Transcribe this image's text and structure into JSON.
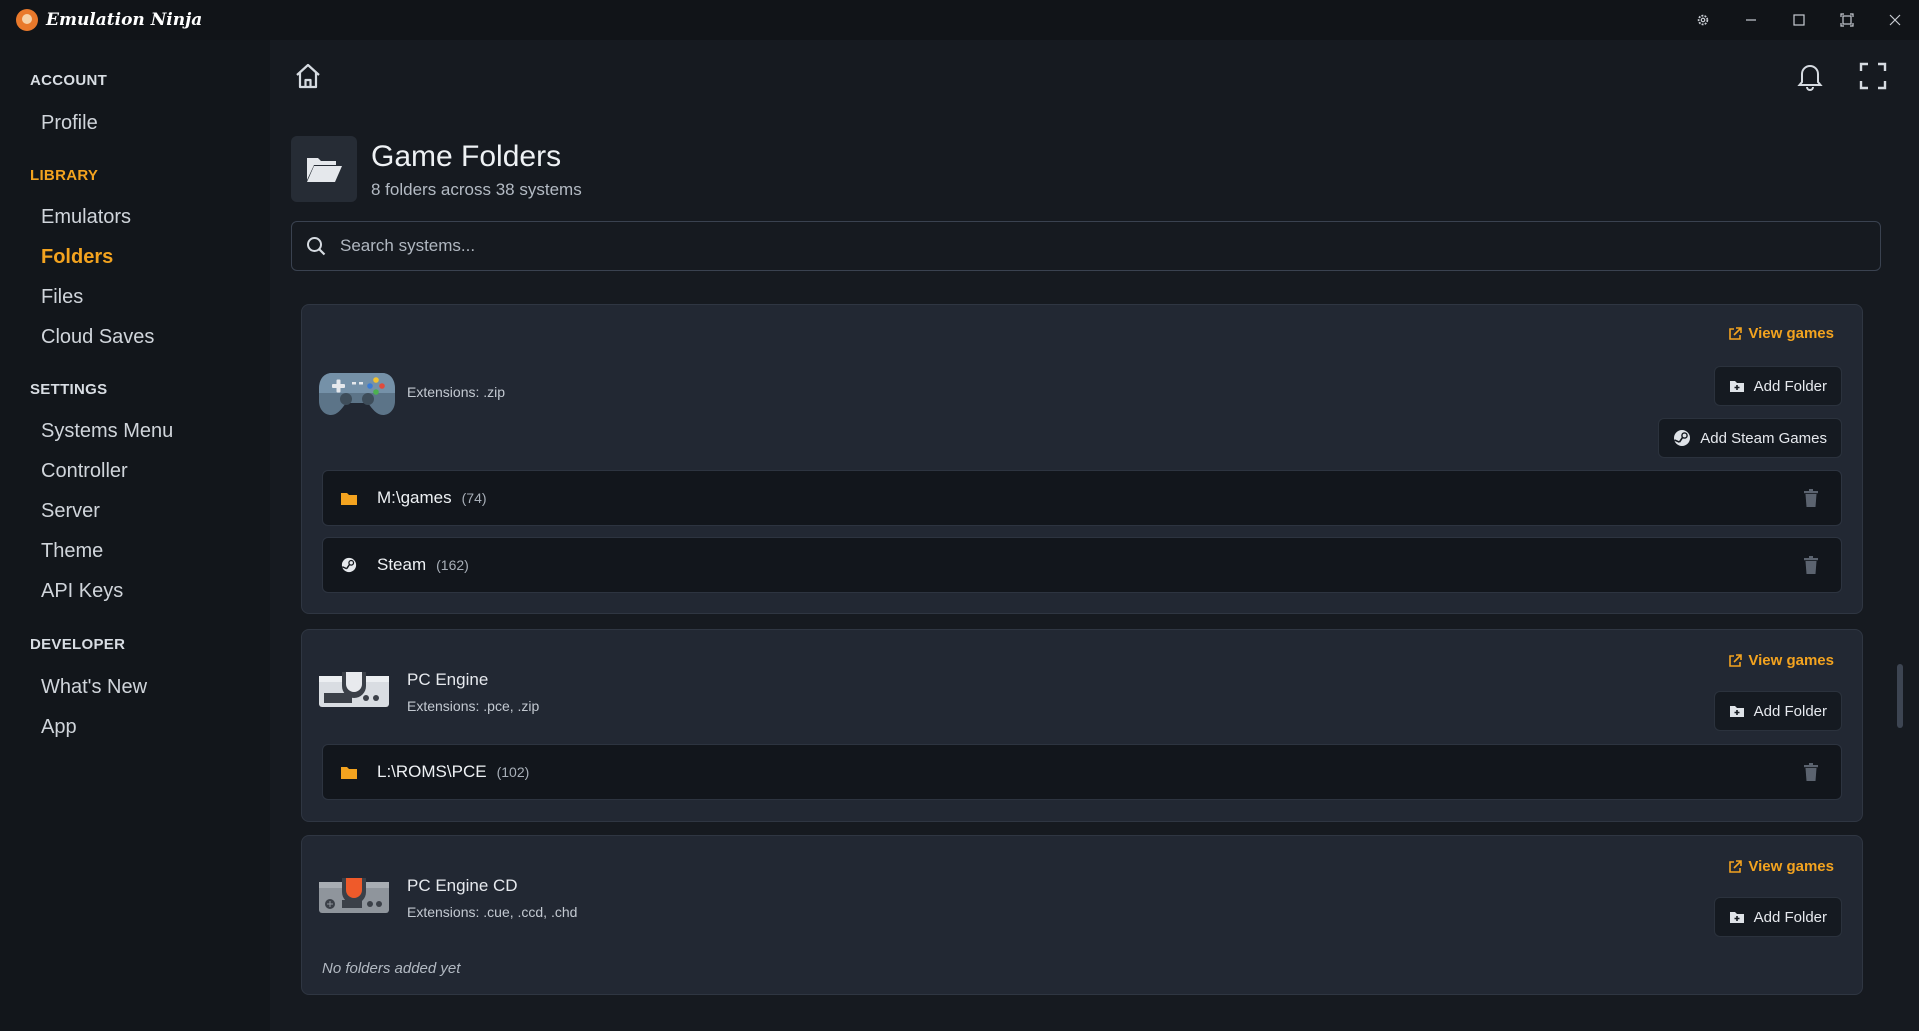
{
  "app": {
    "name": "Emulation Ninja"
  },
  "sidebar": {
    "sections": [
      {
        "label": "ACCOUNT",
        "items": [
          "Profile"
        ]
      },
      {
        "label": "LIBRARY",
        "items": [
          "Emulators",
          "Folders",
          "Files",
          "Cloud Saves"
        ]
      },
      {
        "label": "SETTINGS",
        "items": [
          "Systems Menu",
          "Controller",
          "Server",
          "Theme",
          "API Keys"
        ]
      },
      {
        "label": "DEVELOPER",
        "items": [
          "What's New",
          "App"
        ]
      }
    ],
    "active_item": "Folders",
    "active_section": "LIBRARY"
  },
  "page": {
    "title": "Game Folders",
    "subtitle": "8 folders across 38 systems"
  },
  "search": {
    "placeholder": "Search systems..."
  },
  "systems": [
    {
      "name": "",
      "extensions": "Extensions: .zip",
      "view_games": "View games",
      "add_folder": "Add Folder",
      "add_steam": "Add Steam Games",
      "folders": [
        {
          "path": "M:\\games",
          "count": "(74)",
          "icon": "folder-icon"
        },
        {
          "path": "Steam",
          "count": "(162)",
          "icon": "steam-icon"
        }
      ]
    },
    {
      "name": "PC Engine",
      "extensions": "Extensions: .pce, .zip",
      "view_games": "View games",
      "add_folder": "Add Folder",
      "folders": [
        {
          "path": "L:\\ROMS\\PCE",
          "count": "(102)",
          "icon": "folder-icon"
        }
      ]
    },
    {
      "name": "PC Engine CD",
      "extensions": "Extensions: .cue, .ccd, .chd",
      "view_games": "View games",
      "add_folder": "Add Folder",
      "empty_note": "No folders added yet",
      "folders": []
    }
  ],
  "colors": {
    "accent": "#f3a31f",
    "background": "#161a20",
    "card": "#222833"
  }
}
